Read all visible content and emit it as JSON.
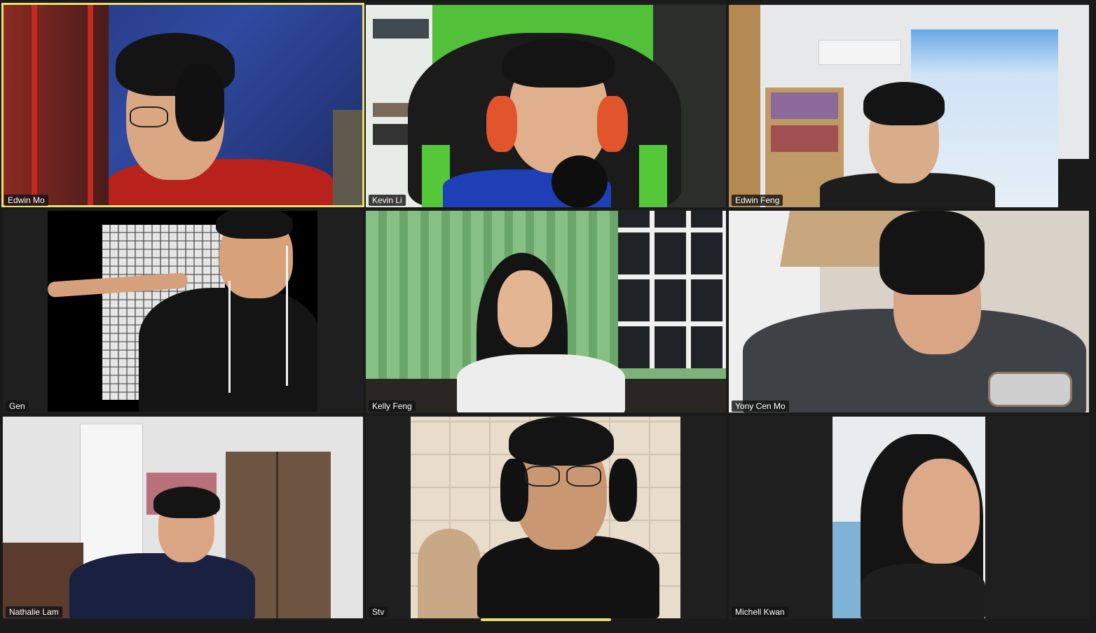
{
  "meeting": {
    "view": "gallery",
    "active_speaker": "Edwin Mo",
    "colors": {
      "background": "#1a1a1a",
      "active_speaker_border": "#e9df6a",
      "name_tag_bg": "#141414",
      "name_tag_text": "#ffffff"
    }
  },
  "participants": [
    {
      "name": "Edwin Mo"
    },
    {
      "name": "Kevin Li"
    },
    {
      "name": "Edwin Feng"
    },
    {
      "name": "Gen"
    },
    {
      "name": "Kelly Feng"
    },
    {
      "name": "Yony Cen Mo"
    },
    {
      "name": "Nathalie Lam"
    },
    {
      "name": "Stv"
    },
    {
      "name": "Michell Kwan"
    }
  ]
}
